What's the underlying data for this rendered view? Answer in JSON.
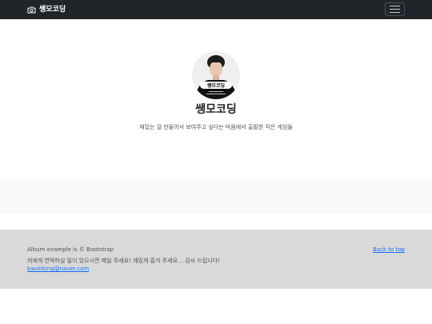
{
  "navbar": {
    "brand_icon": "camera-icon",
    "brand_label": "쌩모코딩",
    "toggler_icon": "hamburger-icon"
  },
  "hero": {
    "title": "쌩모코딩",
    "description": "재밌는 걸 만들어서 보여주고 싶다는 마음에서 출발한 작은 게임들",
    "avatar_caption": "쌩모코딩"
  },
  "footer": {
    "copyright": "Album example is © Bootstrap",
    "back_to_top": "Back to top",
    "note": "저에게 연락하실 일이 있으시면 메일 주세요! 재밌게 즐겨 주세요… 감사 드립니다!",
    "email": "kavinking@naver.com"
  },
  "colors": {
    "navbar_bg": "#212529",
    "footer_bg": "#d9d9d9",
    "album_bg": "#f8f9fa",
    "link": "#0d6efd"
  }
}
